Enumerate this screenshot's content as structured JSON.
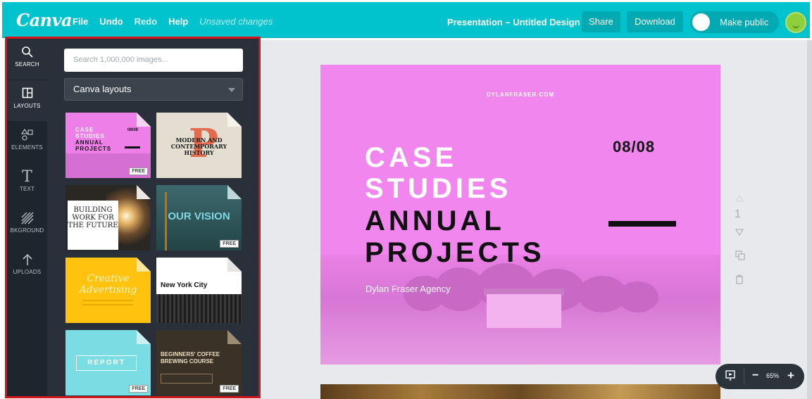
{
  "app": {
    "logo": "Canva",
    "menu": [
      "File",
      "Undo",
      "Redo",
      "Help"
    ],
    "unsaved": "Unsaved changes",
    "title": "Presentation – Untitled Design",
    "share_label": "Share",
    "download_label": "Download",
    "make_public_label": "Make public"
  },
  "rail": [
    {
      "label": "SEARCH",
      "icon": "search-icon"
    },
    {
      "label": "LAYOUTS",
      "icon": "layouts-icon"
    },
    {
      "label": "ELEMENTS",
      "icon": "elements-icon"
    },
    {
      "label": "TEXT",
      "icon": "text-icon"
    },
    {
      "label": "BKGROUND",
      "icon": "background-icon"
    },
    {
      "label": "UPLOADS",
      "icon": "upload-icon"
    }
  ],
  "panel": {
    "search_placeholder": "Search 1,000,000 images...",
    "dropdown_value": "Canva layouts",
    "thumbnails": {
      "t1": {
        "l1": "CASE",
        "l2": "STUDIES",
        "l3": "ANNUAL",
        "l4": "PROJECTS",
        "date": "08/08",
        "badge": "FREE"
      },
      "t2": {
        "l1": "MODERN AND",
        "l2": "CONTEMPORARY",
        "l3": "HISTORY"
      },
      "t3": {
        "l1": "BUILDING",
        "l2": "WORK FOR",
        "l3": "THE FUTURE"
      },
      "t4": {
        "l1": "OUR VISION",
        "badge": "FREE"
      },
      "t5": {
        "l1": "Creative",
        "l2": "Advertising"
      },
      "t6": {
        "l1": "New York City"
      },
      "t7": {
        "l1": "REPORT",
        "badge": "FREE"
      },
      "t8": {
        "l1": "BEGINNERS' COFFEE",
        "l2": "BREWING COURSE",
        "badge": "FREE"
      }
    }
  },
  "slide": {
    "site": "DYLANFRASER.COM",
    "line1": "CASE",
    "line2": "STUDIES",
    "line3": "ANNUAL",
    "line4": "PROJECTS",
    "date": "08/08",
    "agency": "Dylan Fraser Agency",
    "bg_color": "#f286ef"
  },
  "sidebar_tools": {
    "page_number": "1"
  },
  "zoom": {
    "minus": "−",
    "value": "65%",
    "plus": "+"
  },
  "colors": {
    "brand": "#00c4cc",
    "panel": "#293039",
    "highlight": "#d4151b"
  }
}
